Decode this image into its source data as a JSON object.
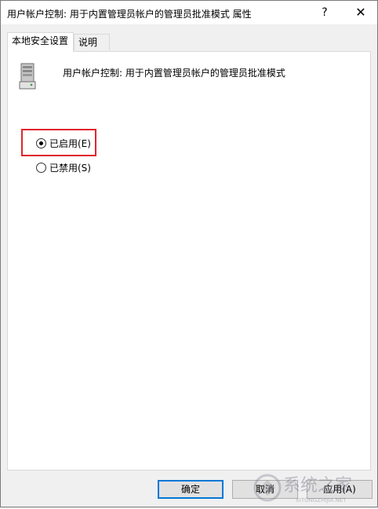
{
  "window": {
    "title": "用户帐户控制: 用于内置管理员帐户的管理员批准模式 属性",
    "help_label": "?",
    "close_label": "✕"
  },
  "tabs": [
    {
      "label": "本地安全设置",
      "active": true
    },
    {
      "label": "说明",
      "active": false
    }
  ],
  "policy": {
    "icon": "server-icon",
    "name": "用户帐户控制: 用于内置管理员帐户的管理员批准模式"
  },
  "options": [
    {
      "label": "已启用(E)",
      "checked": true
    },
    {
      "label": "已禁用(S)",
      "checked": false
    }
  ],
  "buttons": {
    "ok": "确定",
    "cancel": "取消",
    "apply": "应用(A)"
  },
  "watermark": {
    "text": "系统之家",
    "subtext": "XITONGZHIJIA.NET"
  },
  "colors": {
    "highlight": "#e0242c",
    "accent": "#0078d7"
  }
}
